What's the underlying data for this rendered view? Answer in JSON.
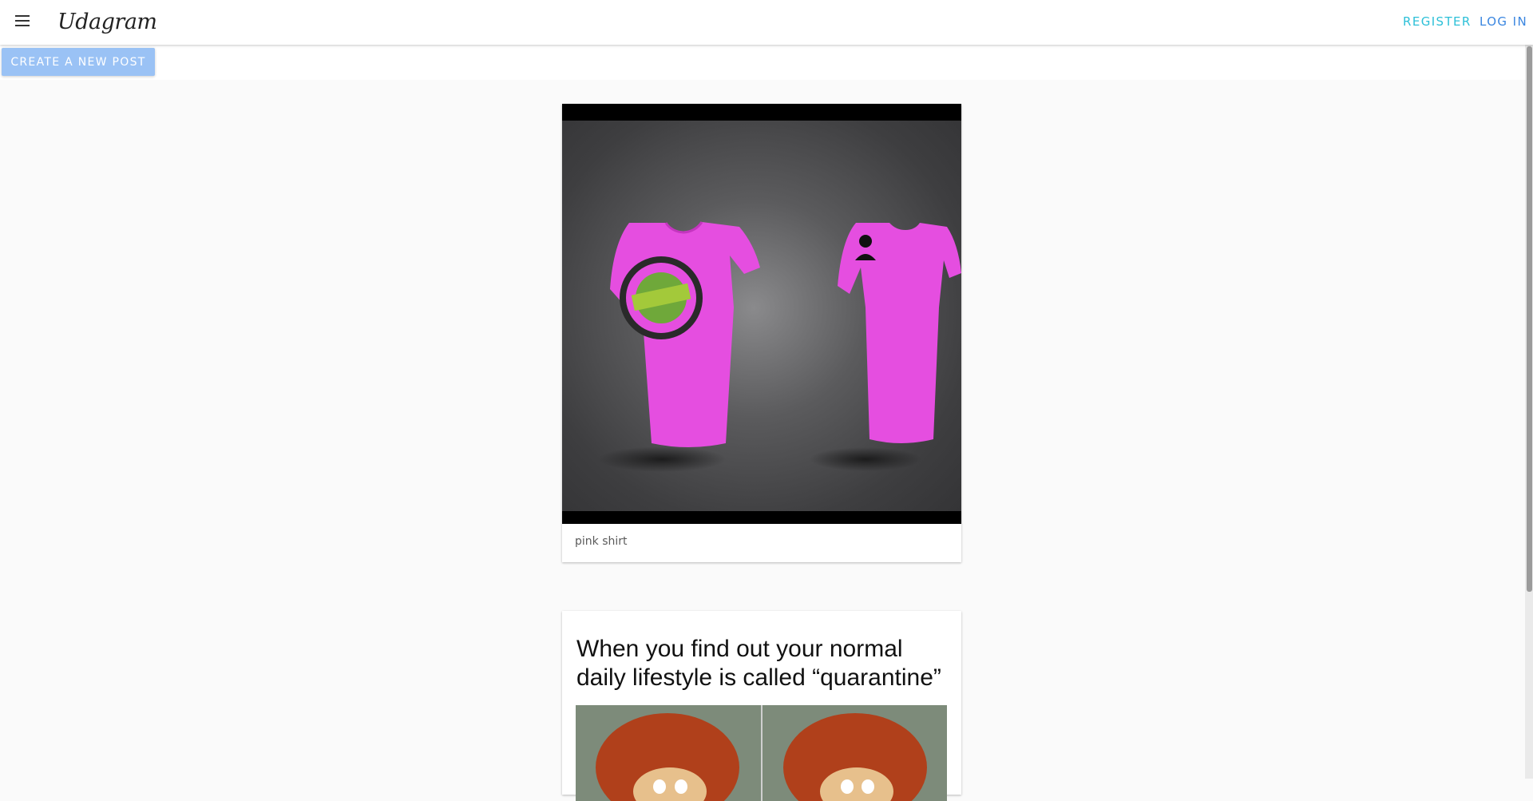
{
  "app": {
    "title": "Udagram"
  },
  "nav": {
    "register_label": "REGISTER",
    "login_label": "LOG IN"
  },
  "actions": {
    "create_post_label": "CREATE A NEW POST"
  },
  "feed": {
    "posts": [
      {
        "caption": "pink shirt"
      },
      {
        "meme_text": "When you find out your normal daily lifestyle is called “quarantine”"
      }
    ]
  },
  "colors": {
    "register_link": "#2dc0d8",
    "login_link": "#3a86e0",
    "create_button": "#9ac2f5",
    "shirt_pink": "#e54ee0",
    "page_background": "#fafafa"
  },
  "icons": {
    "menu": "menu-icon"
  }
}
